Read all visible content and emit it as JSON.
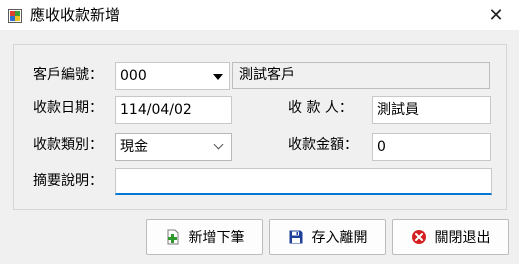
{
  "window": {
    "title": "應收收款新增",
    "icon": "app-window-icon",
    "close_glyph": "✕"
  },
  "form": {
    "customer_no": {
      "label": "客戶編號：",
      "value": "000",
      "name_value": "測試客戶"
    },
    "receipt_date": {
      "label": "收款日期：",
      "value": "114/04/02"
    },
    "receiver": {
      "label": "收 款 人：",
      "value": "測試員"
    },
    "receipt_type": {
      "label": "收款類別：",
      "value": "現金"
    },
    "amount": {
      "label": "收款金額：",
      "value": "0"
    },
    "memo": {
      "label": "摘要說明：",
      "value": ""
    }
  },
  "buttons": {
    "add_next": {
      "label": "新增下筆",
      "icon": "add-document-icon",
      "color": "#2e9a2e"
    },
    "save_exit": {
      "label": "存入離開",
      "icon": "save-disk-icon",
      "color": "#1f3f9a"
    },
    "close_exit": {
      "label": "關閉退出",
      "icon": "close-circle-icon",
      "color": "#d42020"
    }
  }
}
